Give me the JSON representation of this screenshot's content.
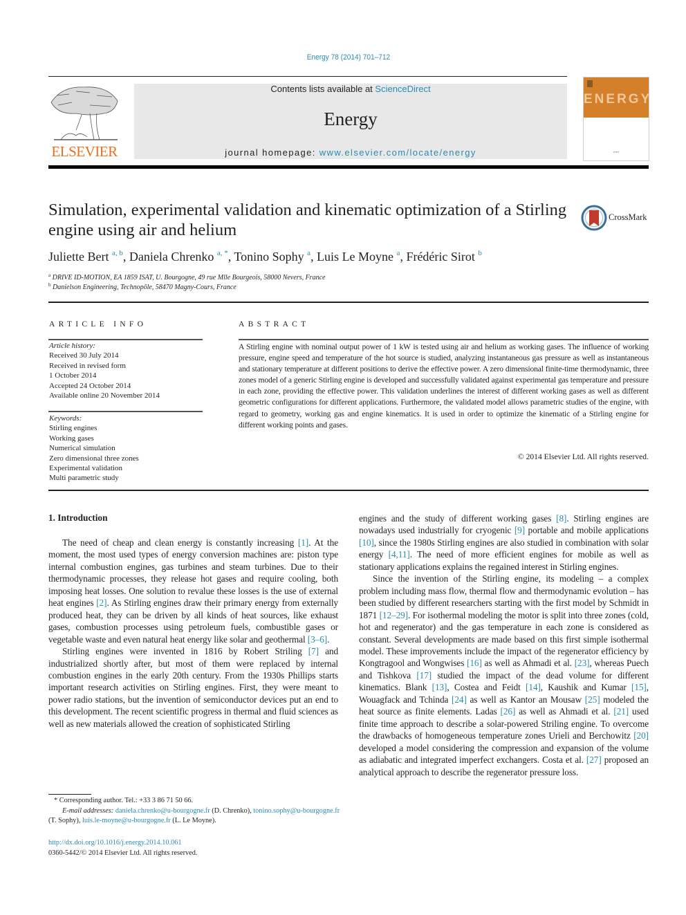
{
  "running_head": "Energy 78 (2014) 701–712",
  "masthead": {
    "contents_prefix": "Contents lists available at ",
    "contents_link": "ScienceDirect",
    "journal_title": "Energy",
    "homepage_prefix": "journal homepage: ",
    "homepage_link": "www.elsevier.com/locate/energy"
  },
  "publisher_logo": {
    "icon": "elsevier-tree-icon",
    "wordmark": "ELSEVIER",
    "color": "#e9711c"
  },
  "cover": {
    "icon": "journal-cover-icon",
    "word": "ENERGY",
    "color": "#d47f2a"
  },
  "crossmark": {
    "icon": "crossmark-icon",
    "label": "CrossMark"
  },
  "article": {
    "title": "Simulation, experimental validation and kinematic optimization of a Stirling engine using air and helium",
    "authors": [
      {
        "name": "Juliette Bert",
        "sup": "a, b"
      },
      {
        "name": "Daniela Chrenko",
        "sup": "a, *"
      },
      {
        "name": "Tonino Sophy",
        "sup": "a"
      },
      {
        "name": "Luis Le Moyne",
        "sup": "a"
      },
      {
        "name": "Frédéric Sirot",
        "sup": "b"
      }
    ],
    "affiliations": [
      {
        "mark": "a",
        "text": "DRIVE ID-MOTION, EA 1859 ISAT, U. Bourgogne, 49 rue Mlle Bourgeois, 58000 Nevers, France"
      },
      {
        "mark": "b",
        "text": "Danielson Engineering, Technopôle, 58470 Magny-Cours, France"
      }
    ]
  },
  "article_info": {
    "heading": "ARTICLE INFO",
    "history_label": "Article history:",
    "history": [
      "Received 30 July 2014",
      "Received in revised form",
      "1 October 2014",
      "Accepted 24 October 2014",
      "Available online 20 November 2014"
    ],
    "keywords_label": "Keywords:",
    "keywords": [
      "Stirling engines",
      "Working gases",
      "Numerical simulation",
      "Zero dimensional three zones",
      "Experimental validation",
      "Multi parametric study"
    ]
  },
  "abstract": {
    "heading": "ABSTRACT",
    "text": "A Stirling engine with nominal output power of 1 kW is tested using air and helium as working gases. The influence of working pressure, engine speed and temperature of the hot source is studied, analyzing instantaneous gas pressure as well as instantaneous and stationary temperature at different positions to derive the effective power. A zero dimensional finite-time thermodynamic, three zones model of a generic Stirling engine is developed and successfully validated against experimental gas temperature and pressure in each zone, providing the effective power. This validation underlines the interest of different working gases as well as different geometric configurations for different applications. Furthermore, the validated model allows parametric studies of the engine, with regard to geometry, working gas and engine kinematics. It is used in order to optimize the kinematic of a Stirling engine for different working points and gases.",
    "copyright": "© 2014 Elsevier Ltd. All rights reserved."
  },
  "introduction": {
    "heading": "1.  Introduction",
    "left_paragraphs": [
      [
        {
          "t": "The need of cheap and clean energy is constantly increasing "
        },
        {
          "ref": "[1]"
        },
        {
          "t": ". At the moment, the most used types of energy conversion machines are: piston type internal combustion engines, gas turbines and steam turbines. Due to their thermodynamic processes, they release hot gases and require cooling, both imposing heat losses. One solution to revalue these losses is the use of external heat engines "
        },
        {
          "ref": "[2]"
        },
        {
          "t": ". As Stirling engines draw their primary energy from externally produced heat, they can be driven by all kinds of heat sources, like exhaust gases, combustion processes using petroleum fuels, combustible gases or vegetable waste and even natural heat energy like solar and geothermal "
        },
        {
          "ref": "[3–6]"
        },
        {
          "t": "."
        }
      ],
      [
        {
          "t": "Stirling engines were invented in 1816 by Robert Striling "
        },
        {
          "ref": "[7]"
        },
        {
          "t": " and industrialized shortly after, but most of them were replaced by internal combustion engines in the early 20th century. From the 1930s Phillips starts important research activities on Stirling engines. First, they were meant to power radio stations, but the invention of semiconductor devices put an end to this development. The recent scientific progress in thermal and fluid sciences as well as new materials allowed the creation of sophisticated Stirling"
        }
      ]
    ],
    "right_paragraphs": [
      [
        {
          "t": "engines and the study of different working gases "
        },
        {
          "ref": "[8]"
        },
        {
          "t": ". Stirling engines are nowadays used industrially for cryogenic "
        },
        {
          "ref": "[9]"
        },
        {
          "t": " portable and mobile applications "
        },
        {
          "ref": "[10]"
        },
        {
          "t": ", since the 1980s Stirling engines are also studied in combination with solar energy "
        },
        {
          "ref": "[4,11]"
        },
        {
          "t": ". The need of more efficient engines for mobile as well as stationary applications explains the regained interest in Stirling engines."
        }
      ],
      [
        {
          "t": "Since the invention of the Stirling engine, its modeling – a complex problem including mass flow, thermal flow and thermodynamic evolution – has been studied by different researchers starting with the first model by Schmidt in 1871 "
        },
        {
          "ref": "[12–29]"
        },
        {
          "t": ". For isothermal modeling the motor is split into three zones (cold, hot and regenerator) and the gas temperature in each zone is considered as constant. Several developments are made based on this first simple isothermal model. These improvements include the impact of the regenerator efficiency by Kongtragool and Wongwises "
        },
        {
          "ref": "[16]"
        },
        {
          "t": " as well as Ahmadi et al. "
        },
        {
          "ref": "[23]"
        },
        {
          "t": ", whereas Puech and Tishkova "
        },
        {
          "ref": "[17]"
        },
        {
          "t": " studied the impact of the dead volume for different kinematics. Blank "
        },
        {
          "ref": "[13]"
        },
        {
          "t": ", Costea and Feidt "
        },
        {
          "ref": "[14]"
        },
        {
          "t": ", Kaushik and Kumar "
        },
        {
          "ref": "[15]"
        },
        {
          "t": ", Wouagfack and Tchinda "
        },
        {
          "ref": "[24]"
        },
        {
          "t": " as well as Kantor an Mousaw "
        },
        {
          "ref": "[25]"
        },
        {
          "t": " modeled the heat source as finite elements. Ladas "
        },
        {
          "ref": "[26]"
        },
        {
          "t": " as well as Ahmadi et al. "
        },
        {
          "ref": "[21]"
        },
        {
          "t": " used finite time approach to describe a solar-powered Striling engine. To overcome the drawbacks of homogeneous temperature zones Urieli and Berchowitz "
        },
        {
          "ref": "[20]"
        },
        {
          "t": " developed a model considering the compression and expansion of the volume as adiabatic and integrated imperfect exchangers. Costa et al. "
        },
        {
          "ref": "[27]"
        },
        {
          "t": " proposed an analytical approach to describe the regenerator pressure loss."
        }
      ]
    ]
  },
  "footnotes": {
    "corresponding": "* Corresponding author. Tel.: +33 3 86 71 50 66.",
    "email_label": "E-mail addresses:",
    "emails": [
      {
        "address": "daniela.chrenko@u-bourgogne.fr",
        "who": " (D. Chrenko), "
      },
      {
        "address": "tonino.sophy@u-bourgogne.fr",
        "who": " (T. Sophy), "
      },
      {
        "address": "luis.le-moyne@u-bourgogne.fr",
        "who": " (L. Le Moyne)."
      }
    ],
    "doi": "http://dx.doi.org/10.1016/j.energy.2014.10.061",
    "issn": "0360-5442/© 2014 Elsevier Ltd. All rights reserved."
  },
  "colors": {
    "link": "#2a8bb3",
    "text": "#231f20",
    "masthead_bg": "#e8e8e8"
  }
}
